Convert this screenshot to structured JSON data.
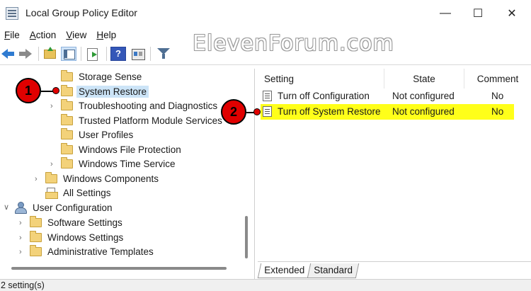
{
  "window": {
    "title": "Local Group Policy Editor",
    "minimize": "—",
    "maximize": "☐",
    "close": "✕"
  },
  "menu": {
    "items": [
      {
        "label": "File",
        "key": "F",
        "rest": "ile"
      },
      {
        "label": "Action",
        "key": "A",
        "rest": "ction"
      },
      {
        "label": "View",
        "key": "V",
        "rest": "iew"
      },
      {
        "label": "Help",
        "key": "H",
        "rest": "elp"
      }
    ]
  },
  "toolbar": {
    "help_glyph": "?"
  },
  "watermark": "ElevenForum.com",
  "tree": {
    "items": [
      {
        "label": "Storage Sense",
        "icon": "folder-icon"
      },
      {
        "label": "System Restore",
        "icon": "folder-icon",
        "selected": true
      },
      {
        "label": "Troubleshooting and Diagnostics",
        "icon": "folder-icon",
        "expandable": true
      },
      {
        "label": "Trusted Platform Module Services",
        "icon": "folder-icon"
      },
      {
        "label": "User Profiles",
        "icon": "folder-icon"
      },
      {
        "label": "Windows File Protection",
        "icon": "folder-icon"
      },
      {
        "label": "Windows Time Service",
        "icon": "folder-icon",
        "expandable": true
      },
      {
        "label": "Windows Components",
        "icon": "folder-icon",
        "expandable": true
      },
      {
        "label": "All Settings",
        "icon": "document-folder-icon"
      },
      {
        "label": "User Configuration",
        "icon": "user-icon",
        "expanded": true
      },
      {
        "label": "Software Settings",
        "icon": "folder-icon",
        "expandable": true
      },
      {
        "label": "Windows Settings",
        "icon": "folder-icon",
        "expandable": true
      },
      {
        "label": "Administrative Templates",
        "icon": "folder-icon",
        "expandable": true
      }
    ]
  },
  "list": {
    "columns": [
      "Setting",
      "State",
      "Comment"
    ],
    "rows": [
      {
        "setting": "Turn off Configuration",
        "state": "Not configured",
        "comment": "No"
      },
      {
        "setting": "Turn off System Restore",
        "state": "Not configured",
        "comment": "No",
        "highlighted": true
      }
    ]
  },
  "tabs": [
    "Extended",
    "Standard"
  ],
  "status": "2 setting(s)",
  "markers": [
    "1",
    "2"
  ],
  "colors": {
    "highlight": "#ffff1a",
    "selection": "#cce4f7",
    "marker": "#e00000"
  }
}
